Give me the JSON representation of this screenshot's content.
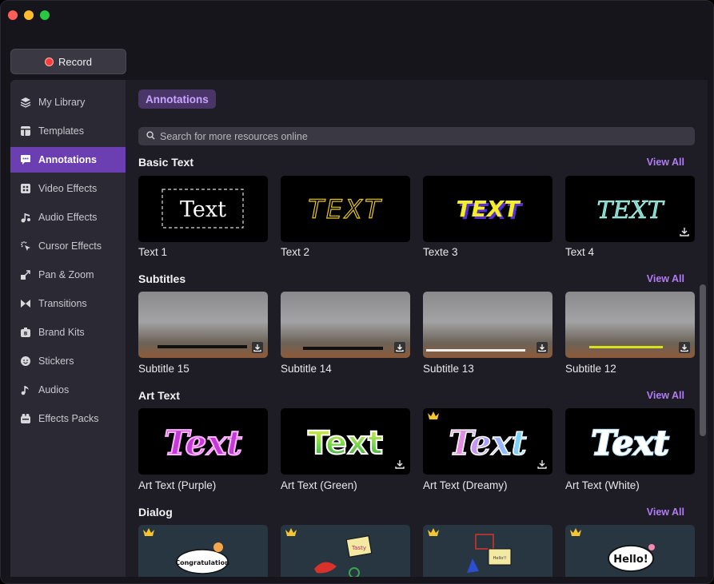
{
  "window": {
    "controls": [
      "close",
      "minimize",
      "zoom"
    ]
  },
  "record": {
    "label": "Record"
  },
  "sidebar": {
    "items": [
      {
        "label": "My Library",
        "icon": "layers-icon"
      },
      {
        "label": "Templates",
        "icon": "templates-icon"
      },
      {
        "label": "Annotations",
        "icon": "annotation-icon",
        "active": true
      },
      {
        "label": "Video Effects",
        "icon": "video-effects-icon"
      },
      {
        "label": "Audio Effects",
        "icon": "audio-effects-icon"
      },
      {
        "label": "Cursor Effects",
        "icon": "cursor-effects-icon"
      },
      {
        "label": "Pan & Zoom",
        "icon": "pan-zoom-icon"
      },
      {
        "label": "Transitions",
        "icon": "transitions-icon"
      },
      {
        "label": "Brand Kits",
        "icon": "brand-kits-icon"
      },
      {
        "label": "Stickers",
        "icon": "stickers-icon"
      },
      {
        "label": "Audios",
        "icon": "audios-icon"
      },
      {
        "label": "Effects Packs",
        "icon": "effects-packs-icon"
      }
    ]
  },
  "main": {
    "tab": "Annotations",
    "search_placeholder": "Search for more resources online",
    "view_all": "View All",
    "sections": [
      {
        "title": "Basic Text",
        "items": [
          {
            "label": "Text 1",
            "preview": "Text"
          },
          {
            "label": "Text 2",
            "preview": "TEXT"
          },
          {
            "label": "Texte 3",
            "preview": "TEXT"
          },
          {
            "label": "Text 4",
            "preview": "TEXT",
            "download": true
          }
        ]
      },
      {
        "title": "Subtitles",
        "items": [
          {
            "label": "Subtitle 15",
            "download": true
          },
          {
            "label": "Subtitle 14",
            "download": true
          },
          {
            "label": "Subtitle 13",
            "download": true
          },
          {
            "label": "Subtitle 12",
            "download": true
          }
        ]
      },
      {
        "title": "Art Text",
        "items": [
          {
            "label": "Art Text (Purple)",
            "preview": "Text"
          },
          {
            "label": "Art Text (Green)",
            "preview": "Text",
            "download": true
          },
          {
            "label": "Art Text (Dreamy)",
            "preview": "Text",
            "download": true,
            "premium": true
          },
          {
            "label": "Art Text (White)",
            "preview": "Text"
          }
        ]
      },
      {
        "title": "Dialog",
        "items": [
          {
            "preview": "Congratulation",
            "premium": true
          },
          {
            "preview": "Tasty",
            "premium": true
          },
          {
            "preview": "Hello!!",
            "premium": true
          },
          {
            "preview": "Hello!",
            "premium": true
          }
        ]
      }
    ]
  },
  "colors": {
    "accent": "#6b3fb2",
    "view_all": "#b17cf4",
    "record_dot": "#ff3b3b"
  }
}
